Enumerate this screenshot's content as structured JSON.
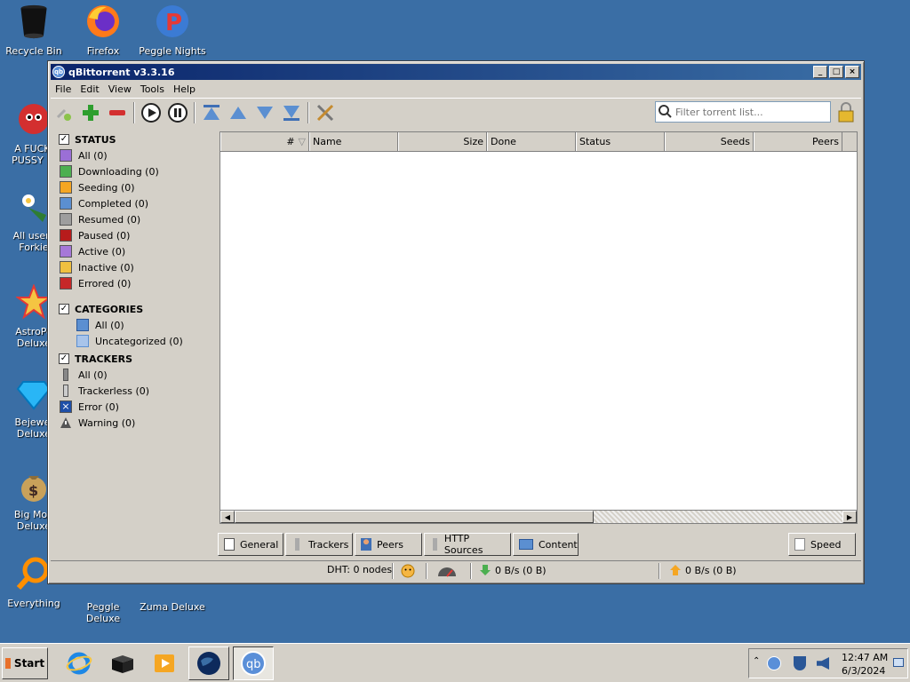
{
  "desktop": {
    "icons": [
      {
        "label": "Recycle Bin"
      },
      {
        "label": "Firefox"
      },
      {
        "label": "Peggle Nights"
      },
      {
        "label": "A FUCKI\nPUSSY BI"
      },
      {
        "label": "All users\nForkie"
      },
      {
        "label": "AstroPo\nDeluxe"
      },
      {
        "label": "Bejewel\nDeluxe"
      },
      {
        "label": "Big Mon\nDeluxe"
      },
      {
        "label": "Everything"
      },
      {
        "label": "Peggle Deluxe"
      },
      {
        "label": "Zuma Deluxe"
      }
    ]
  },
  "window": {
    "title": "qBittorrent v3.3.16",
    "menu": [
      "File",
      "Edit",
      "View",
      "Tools",
      "Help"
    ],
    "filter_placeholder": "Filter torrent list..."
  },
  "sidebar": {
    "status": {
      "heading": "STATUS",
      "items": [
        {
          "label": "All (0)",
          "color": "#9b6fd6"
        },
        {
          "label": "Downloading (0)",
          "color": "#4caf50"
        },
        {
          "label": "Seeding (0)",
          "color": "#f5a623"
        },
        {
          "label": "Completed (0)",
          "color": "#5b8fd1"
        },
        {
          "label": "Resumed (0)",
          "color": "#9e9e9e"
        },
        {
          "label": "Paused (0)",
          "color": "#b71c1c"
        },
        {
          "label": "Active (0)",
          "color": "#a678d8"
        },
        {
          "label": "Inactive (0)",
          "color": "#f0c040"
        },
        {
          "label": "Errored (0)",
          "color": "#c62828"
        }
      ]
    },
    "categories": {
      "heading": "CATEGORIES",
      "items": [
        {
          "label": "All (0)"
        },
        {
          "label": "Uncategorized (0)"
        }
      ]
    },
    "trackers": {
      "heading": "TRACKERS",
      "items": [
        {
          "label": "All (0)"
        },
        {
          "label": "Trackerless (0)"
        },
        {
          "label": "Error (0)"
        },
        {
          "label": "Warning (0)"
        }
      ]
    }
  },
  "table": {
    "columns": [
      "#",
      "Name",
      "Size",
      "Done",
      "Status",
      "Seeds",
      "Peers"
    ]
  },
  "tabs": [
    "General",
    "Trackers",
    "Peers",
    "HTTP Sources",
    "Content",
    "Speed"
  ],
  "statusbar": {
    "dht": "DHT: 0 nodes",
    "down": "0 B/s (0 B)",
    "up": "0 B/s (0 B)"
  },
  "taskbar": {
    "start": "Start",
    "time": "12:47 AM",
    "date": "6/3/2024"
  }
}
